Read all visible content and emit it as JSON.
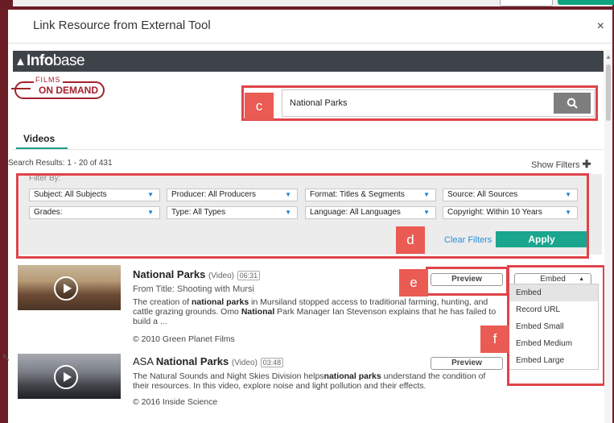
{
  "modal": {
    "title": "Link Resource from External Tool",
    "close": "×"
  },
  "header": {
    "brand": "Info",
    "brand_light": "base",
    "fod_top": "FILMS",
    "fod_bottom": "ON DEMAND"
  },
  "search": {
    "value": "National Parks",
    "button_icon": "search-icon"
  },
  "tabs": {
    "videos": "Videos"
  },
  "results": {
    "count_text": "Search Results: 1 - 20 of 431",
    "show_filters": "Show Filters",
    "show_filters_icon": "plus-icon"
  },
  "filters": {
    "heading": "Filter By:",
    "row1": [
      "Subject: All Subjects",
      "Producer: All Producers",
      "Format: Titles & Segments",
      "Source: All Sources"
    ],
    "row2": [
      "Grades:",
      "Type: All Types",
      "Language: All Languages",
      "Copyright: Within 10 Years"
    ],
    "clear": "Clear Filters",
    "apply": "Apply"
  },
  "annotations": {
    "c": "c",
    "d": "d",
    "e": "e",
    "f": "f"
  },
  "items": [
    {
      "title": "National Parks",
      "type": "(Video)",
      "duration": "06:31",
      "from": "From Title: Shooting with Mursi",
      "desc_1": "The creation of ",
      "desc_2": "national parks",
      "desc_3": " in Mursiland stopped access to traditional farming, hunting, and cattle grazing grounds. Omo ",
      "desc_4": "National",
      "desc_5": " Park Manager Ian Stevenson explains that he has failed to build a ...",
      "copyright": "© 2010 Green Planet Films",
      "preview": "Preview",
      "embed": "Embed"
    },
    {
      "title_prefix": "ASA ",
      "title": "National Parks",
      "type": "(Video)",
      "duration": "03:48",
      "desc_1": "The Natural Sounds and Night Skies Division helps",
      "desc_2": "national parks",
      "desc_3": " understand the condition of their resources. In this video, explore noise and light pollution and their effects.",
      "copyright": "© 2016 Inside Science",
      "preview": "Preview"
    }
  ],
  "embed_menu": [
    "Embed",
    "Record URL",
    "Embed Small",
    "Embed Medium",
    "Embed Large"
  ],
  "colors": {
    "frame": "#6b1d26",
    "accent": "#19a58e",
    "highlight": "#e0434a",
    "link": "#2b8fd6"
  }
}
